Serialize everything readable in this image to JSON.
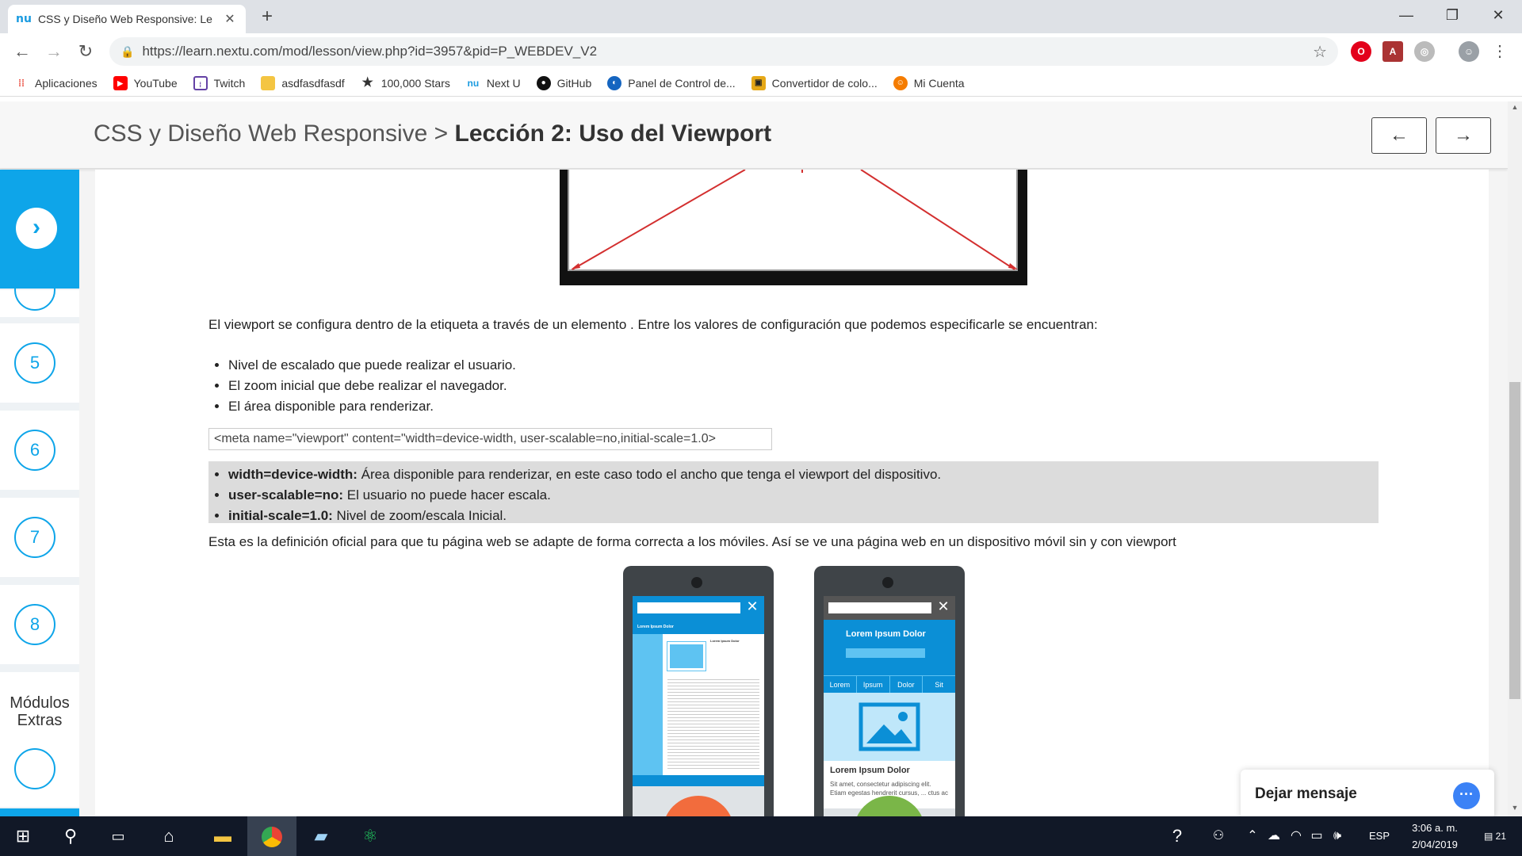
{
  "browser": {
    "tab_title": "CSS y Diseño Web Responsive: Le",
    "url": "https://learn.nextu.com/mod/lesson/view.php?id=3957&pid=P_WEBDEV_V2",
    "bookmarks": [
      {
        "label": "Aplicaciones",
        "icon": "apps-grid-icon",
        "color": "#e94235"
      },
      {
        "label": "YouTube",
        "icon": "youtube-icon",
        "color": "#ff0000"
      },
      {
        "label": "Twitch",
        "icon": "twitch-icon",
        "color": "#6441a5"
      },
      {
        "label": "asdfasdfasdf",
        "icon": "folder-icon",
        "color": "#f4c542"
      },
      {
        "label": "100,000 Stars",
        "icon": "star-icon",
        "color": "#111111"
      },
      {
        "label": "Next U",
        "icon": "nextu-icon",
        "color": "#1a9be0"
      },
      {
        "label": "GitHub",
        "icon": "github-icon",
        "color": "#111111"
      },
      {
        "label": "Panel de Control de...",
        "icon": "panel-icon",
        "color": "#1565c0"
      },
      {
        "label": "Convertidor de colo...",
        "icon": "converter-icon",
        "color": "#e6a817"
      },
      {
        "label": "Mi Cuenta",
        "icon": "account-icon",
        "color": "#f57c00"
      }
    ]
  },
  "header": {
    "course": "CSS y Diseño Web Responsive",
    "separator": ">",
    "lesson": "Lección 2: Uso del Viewport",
    "prev_label": "←",
    "next_label": "→"
  },
  "sidebar": {
    "go_label": "›",
    "items": [
      "5",
      "6",
      "7",
      "8"
    ],
    "modules_label": "Módulos Extras"
  },
  "content": {
    "intro": "El viewport se configura dentro de la etiqueta a través de un elemento . Entre los valores de configuración que podemos especificarle se encuentran:",
    "bullets": [
      "Nivel de escalado que puede realizar el usuario.",
      "El zoom inicial que debe realizar el navegador.",
      "El área disponible para renderizar."
    ],
    "code": "<meta name=\"viewport\" content=\"width=device-width, user-scalable=no,initial-scale=1.0>",
    "attributes": [
      {
        "key": "width=device-width:",
        "desc": " Área disponible para renderizar, en este caso todo el ancho que tenga el viewport del dispositivo."
      },
      {
        "key": "user-scalable=no:",
        "desc": " El usuario no puede hacer escala."
      },
      {
        "key": "initial-scale=1.0:",
        "desc": " Nivel de zoom/escala Inicial."
      }
    ],
    "definition": "Esta es la definición oficial para que tu página web se adapte de forma correcta a los móviles. Así se ve una página web en un dispositivo móvil sin y con viewport"
  },
  "phone_left": {
    "header": "Lorem Ipsum Dolor",
    "side_title": "Lorem Ipsum Dolor"
  },
  "phone_right": {
    "header": "Lorem Ipsum Dolor",
    "nav": [
      "Lorem",
      "Ipsum",
      "Dolor",
      "Sit"
    ],
    "article_title": "Lorem Ipsum Dolor",
    "article_text": "Sit amet, consectetur adipiscing elit. Etiam egestas hendrerit cursus, ... ctus ac"
  },
  "chat": {
    "label": "Dejar mensaje"
  },
  "taskbar": {
    "language": "ESP",
    "time": "3:06 a. m.",
    "date": "2/04/2019",
    "notifications": "21"
  },
  "colors": {
    "accent": "#0ea5e9",
    "chat": "#3b82f6"
  }
}
